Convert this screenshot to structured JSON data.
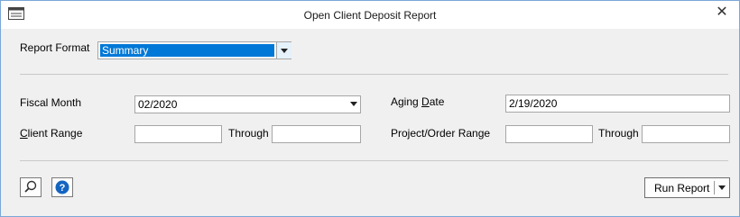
{
  "window": {
    "title": "Open Client Deposit Report",
    "close_glyph": "✕"
  },
  "report_format": {
    "label": "Report Format",
    "value": "Summary"
  },
  "fiscal_month": {
    "label": "Fiscal Month",
    "value": "02/2020"
  },
  "aging_date": {
    "label_pre": "Aging ",
    "label_accel": "D",
    "label_post": "ate",
    "value": "2/19/2020"
  },
  "client_range": {
    "label_accel": "C",
    "label_post": "lient Range",
    "from": "",
    "through_label": "Through",
    "through": ""
  },
  "project_range": {
    "label": "Project/Order Range",
    "from": "",
    "through_label": "Through",
    "through": ""
  },
  "buttons": {
    "run_report": "Run Report"
  },
  "icons": {
    "app": "report-window-icon",
    "search": "magnifier-icon",
    "help": "help-icon"
  },
  "colors": {
    "selection": "#0078d7",
    "help_blue": "#1565c0"
  }
}
